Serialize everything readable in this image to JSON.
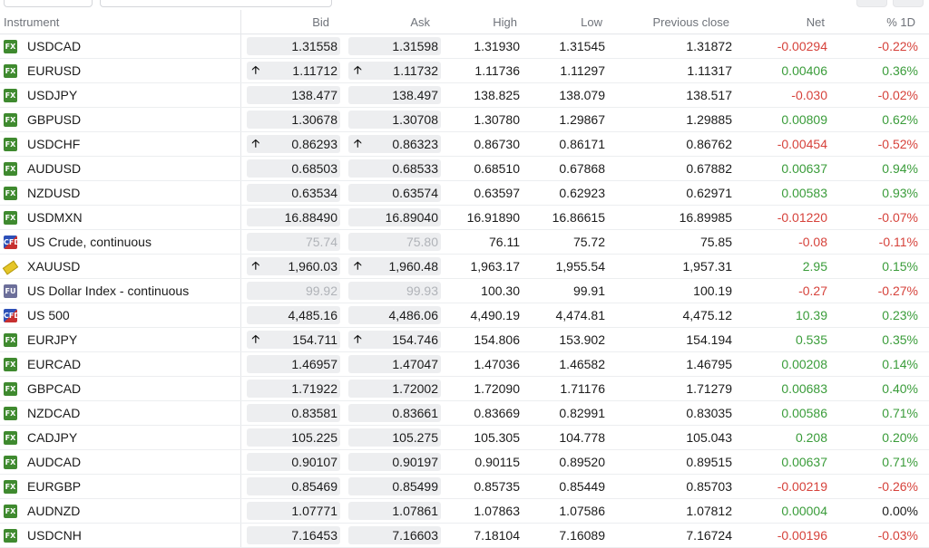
{
  "columns": {
    "instrument": "Instrument",
    "bid": "Bid",
    "ask": "Ask",
    "high": "High",
    "low": "Low",
    "prev": "Previous close",
    "net": "Net",
    "pct": "% 1D"
  },
  "colors": {
    "positive": "#3a9c3a",
    "negative": "#d6423b",
    "fx_badge": "#3f8a2f"
  },
  "rows": [
    {
      "type": "fx",
      "name": "USDCAD",
      "bid": "1.31558",
      "ask": "1.31598",
      "high": "1.31930",
      "low": "1.31545",
      "prev": "1.31872",
      "net": "-0.00294",
      "pct": "-0.22%",
      "trend": "neg",
      "arrow": false,
      "dim": false
    },
    {
      "type": "fx",
      "name": "EURUSD",
      "bid": "1.11712",
      "ask": "1.11732",
      "high": "1.11736",
      "low": "1.11297",
      "prev": "1.11317",
      "net": "0.00406",
      "pct": "0.36%",
      "trend": "pos",
      "arrow": true,
      "dim": false
    },
    {
      "type": "fx",
      "name": "USDJPY",
      "bid": "138.477",
      "ask": "138.497",
      "high": "138.825",
      "low": "138.079",
      "prev": "138.517",
      "net": "-0.030",
      "pct": "-0.02%",
      "trend": "neg",
      "arrow": false,
      "dim": false
    },
    {
      "type": "fx",
      "name": "GBPUSD",
      "bid": "1.30678",
      "ask": "1.30708",
      "high": "1.30780",
      "low": "1.29867",
      "prev": "1.29885",
      "net": "0.00809",
      "pct": "0.62%",
      "trend": "pos",
      "arrow": false,
      "dim": false
    },
    {
      "type": "fx",
      "name": "USDCHF",
      "bid": "0.86293",
      "ask": "0.86323",
      "high": "0.86730",
      "low": "0.86171",
      "prev": "0.86762",
      "net": "-0.00454",
      "pct": "-0.52%",
      "trend": "neg",
      "arrow": true,
      "dim": false
    },
    {
      "type": "fx",
      "name": "AUDUSD",
      "bid": "0.68503",
      "ask": "0.68533",
      "high": "0.68510",
      "low": "0.67868",
      "prev": "0.67882",
      "net": "0.00637",
      "pct": "0.94%",
      "trend": "pos",
      "arrow": false,
      "dim": false
    },
    {
      "type": "fx",
      "name": "NZDUSD",
      "bid": "0.63534",
      "ask": "0.63574",
      "high": "0.63597",
      "low": "0.62923",
      "prev": "0.62971",
      "net": "0.00583",
      "pct": "0.93%",
      "trend": "pos",
      "arrow": false,
      "dim": false
    },
    {
      "type": "fx",
      "name": "USDMXN",
      "bid": "16.88490",
      "ask": "16.89040",
      "high": "16.91890",
      "low": "16.86615",
      "prev": "16.89985",
      "net": "-0.01220",
      "pct": "-0.07%",
      "trend": "neg",
      "arrow": false,
      "dim": false
    },
    {
      "type": "cfd",
      "name": "US Crude, continuous",
      "bid": "75.74",
      "ask": "75.80",
      "high": "76.11",
      "low": "75.72",
      "prev": "75.85",
      "net": "-0.08",
      "pct": "-0.11%",
      "trend": "neg",
      "arrow": false,
      "dim": true
    },
    {
      "type": "gold",
      "name": "XAUUSD",
      "bid": "1,960.03",
      "ask": "1,960.48",
      "high": "1,963.17",
      "low": "1,955.54",
      "prev": "1,957.31",
      "net": "2.95",
      "pct": "0.15%",
      "trend": "pos",
      "arrow": true,
      "dim": false
    },
    {
      "type": "fu",
      "name": "US Dollar Index - continuous",
      "bid": "99.92",
      "ask": "99.93",
      "high": "100.30",
      "low": "99.91",
      "prev": "100.19",
      "net": "-0.27",
      "pct": "-0.27%",
      "trend": "neg",
      "arrow": false,
      "dim": true
    },
    {
      "type": "cfd",
      "name": "US 500",
      "bid": "4,485.16",
      "ask": "4,486.06",
      "high": "4,490.19",
      "low": "4,474.81",
      "prev": "4,475.12",
      "net": "10.39",
      "pct": "0.23%",
      "trend": "pos",
      "arrow": false,
      "dim": false
    },
    {
      "type": "fx",
      "name": "EURJPY",
      "bid": "154.711",
      "ask": "154.746",
      "high": "154.806",
      "low": "153.902",
      "prev": "154.194",
      "net": "0.535",
      "pct": "0.35%",
      "trend": "pos",
      "arrow": true,
      "dim": false
    },
    {
      "type": "fx",
      "name": "EURCAD",
      "bid": "1.46957",
      "ask": "1.47047",
      "high": "1.47036",
      "low": "1.46582",
      "prev": "1.46795",
      "net": "0.00208",
      "pct": "0.14%",
      "trend": "pos",
      "arrow": false,
      "dim": false
    },
    {
      "type": "fx",
      "name": "GBPCAD",
      "bid": "1.71922",
      "ask": "1.72002",
      "high": "1.72090",
      "low": "1.71176",
      "prev": "1.71279",
      "net": "0.00683",
      "pct": "0.40%",
      "trend": "pos",
      "arrow": false,
      "dim": false
    },
    {
      "type": "fx",
      "name": "NZDCAD",
      "bid": "0.83581",
      "ask": "0.83661",
      "high": "0.83669",
      "low": "0.82991",
      "prev": "0.83035",
      "net": "0.00586",
      "pct": "0.71%",
      "trend": "pos",
      "arrow": false,
      "dim": false
    },
    {
      "type": "fx",
      "name": "CADJPY",
      "bid": "105.225",
      "ask": "105.275",
      "high": "105.305",
      "low": "104.778",
      "prev": "105.043",
      "net": "0.208",
      "pct": "0.20%",
      "trend": "pos",
      "arrow": false,
      "dim": false
    },
    {
      "type": "fx",
      "name": "AUDCAD",
      "bid": "0.90107",
      "ask": "0.90197",
      "high": "0.90115",
      "low": "0.89520",
      "prev": "0.89515",
      "net": "0.00637",
      "pct": "0.71%",
      "trend": "pos",
      "arrow": false,
      "dim": false
    },
    {
      "type": "fx",
      "name": "EURGBP",
      "bid": "0.85469",
      "ask": "0.85499",
      "high": "0.85735",
      "low": "0.85449",
      "prev": "0.85703",
      "net": "-0.00219",
      "pct": "-0.26%",
      "trend": "neg",
      "arrow": false,
      "dim": false
    },
    {
      "type": "fx",
      "name": "AUDNZD",
      "bid": "1.07771",
      "ask": "1.07861",
      "high": "1.07863",
      "low": "1.07586",
      "prev": "1.07812",
      "net": "0.00004",
      "pct": "0.00%",
      "trend": "pos",
      "pct_trend": "zero",
      "arrow": false,
      "dim": false
    },
    {
      "type": "fx",
      "name": "USDCNH",
      "bid": "7.16453",
      "ask": "7.16603",
      "high": "7.18104",
      "low": "7.16089",
      "prev": "7.16724",
      "net": "-0.00196",
      "pct": "-0.03%",
      "trend": "neg",
      "arrow": false,
      "dim": false
    }
  ]
}
